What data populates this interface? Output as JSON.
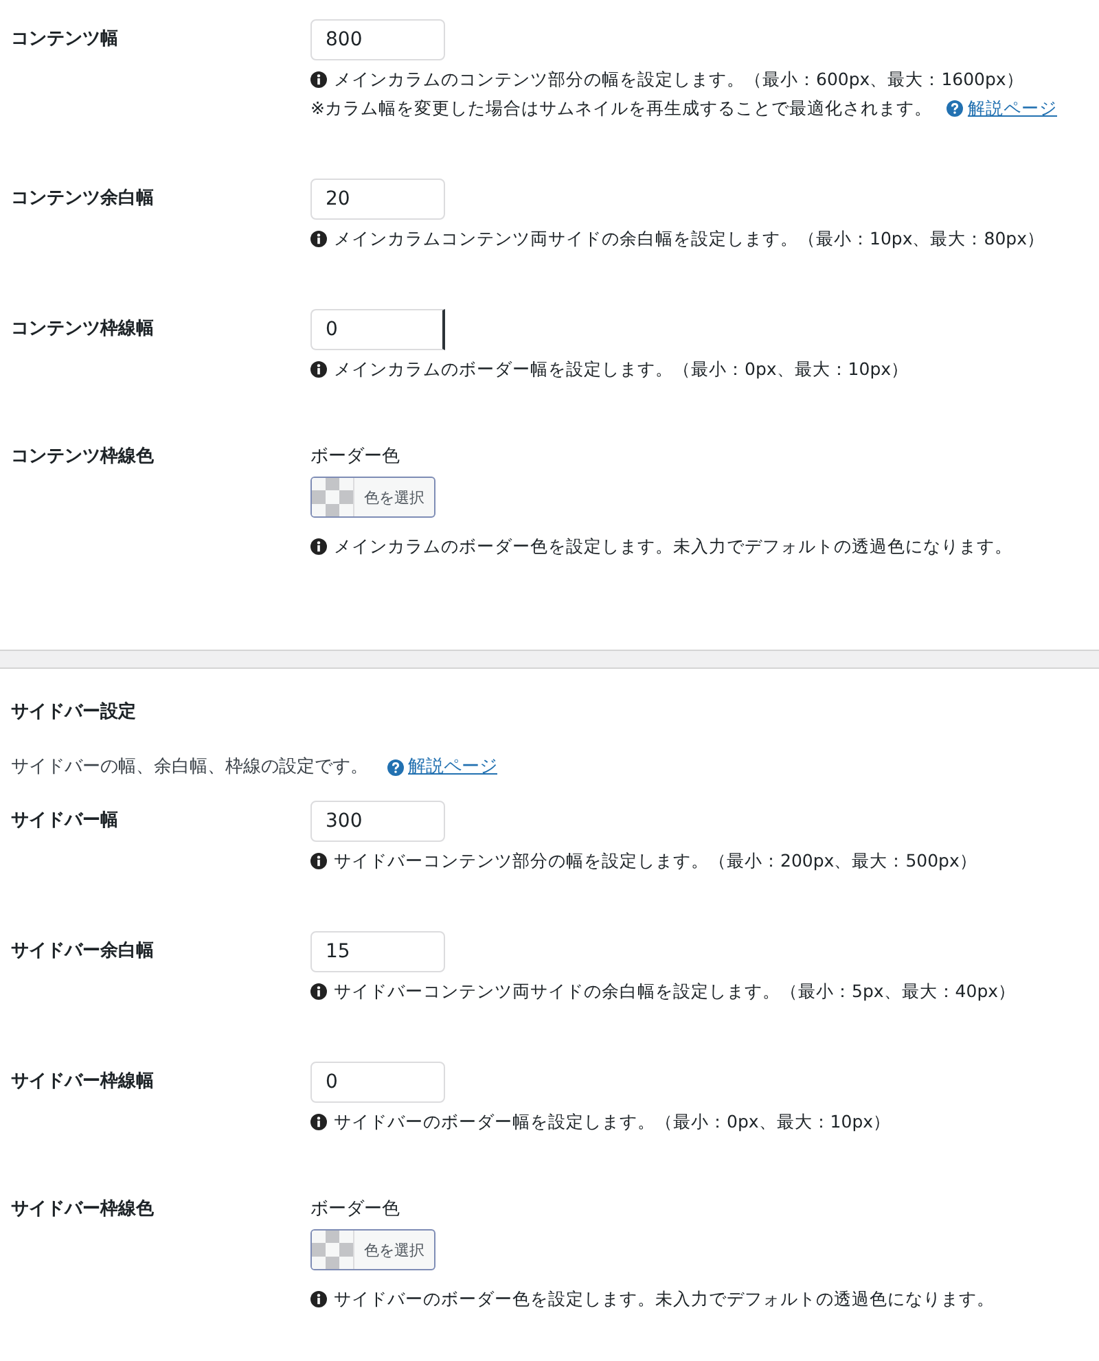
{
  "sections": [
    {
      "rows": [
        {
          "kind": "number",
          "label": "コンテンツ幅",
          "value": "800",
          "focused": false,
          "help": [
            {
              "kind": "info",
              "text": "メインカラムのコンテンツ部分の幅を設定します。（最小：600px、最大：1600px）"
            },
            {
              "kind": "note",
              "text": "※カラム幅を変更した場合はサムネイルを再生成することで最適化されます。",
              "link": "解説ページ"
            }
          ]
        },
        {
          "kind": "number",
          "label": "コンテンツ余白幅",
          "value": "20",
          "focused": false,
          "help": [
            {
              "kind": "info",
              "text": "メインカラムコンテンツ両サイドの余白幅を設定します。（最小：10px、最大：80px）"
            }
          ]
        },
        {
          "kind": "number",
          "label": "コンテンツ枠線幅",
          "value": "0",
          "focused": true,
          "help": [
            {
              "kind": "info",
              "text": "メインカラムのボーダー幅を設定します。（最小：0px、最大：10px）"
            }
          ]
        },
        {
          "kind": "color",
          "label": "コンテンツ枠線色",
          "caption": "ボーダー色",
          "button": "色を選択",
          "help": [
            {
              "kind": "info",
              "text": "メインカラムのボーダー色を設定します。未入力でデフォルトの透過色になります。"
            }
          ]
        }
      ]
    },
    {
      "heading": "サイドバー設定",
      "description": "サイドバーの幅、余白幅、枠線の設定です。",
      "link": "解説ページ",
      "rows": [
        {
          "kind": "number",
          "label": "サイドバー幅",
          "value": "300",
          "focused": false,
          "help": [
            {
              "kind": "info",
              "text": "サイドバーコンテンツ部分の幅を設定します。（最小：200px、最大：500px）"
            }
          ]
        },
        {
          "kind": "number",
          "label": "サイドバー余白幅",
          "value": "15",
          "focused": false,
          "help": [
            {
              "kind": "info",
              "text": "サイドバーコンテンツ両サイドの余白幅を設定します。（最小：5px、最大：40px）"
            }
          ]
        },
        {
          "kind": "number",
          "label": "サイドバー枠線幅",
          "value": "0",
          "focused": false,
          "help": [
            {
              "kind": "info",
              "text": "サイドバーのボーダー幅を設定します。（最小：0px、最大：10px）"
            }
          ]
        },
        {
          "kind": "color",
          "label": "サイドバー枠線色",
          "caption": "ボーダー色",
          "button": "色を選択",
          "help": [
            {
              "kind": "info",
              "text": "サイドバーのボーダー色を設定します。未入力でデフォルトの透過色になります。"
            }
          ]
        }
      ]
    }
  ]
}
